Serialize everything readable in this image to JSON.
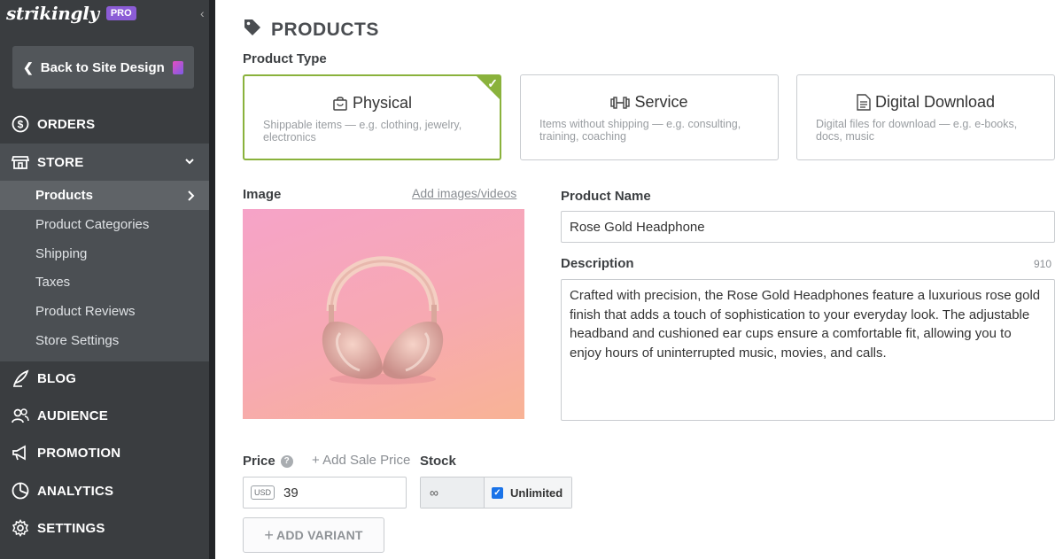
{
  "brand": {
    "logo": "strikingly",
    "badge": "PRO"
  },
  "sidebar": {
    "back_label": "Back to Site Design",
    "items": [
      {
        "label": "ORDERS",
        "icon": "dollar-circle-icon"
      },
      {
        "label": "STORE",
        "icon": "storefront-icon"
      },
      {
        "label": "BLOG",
        "icon": "quill-icon"
      },
      {
        "label": "AUDIENCE",
        "icon": "people-icon"
      },
      {
        "label": "PROMOTION",
        "icon": "megaphone-icon"
      },
      {
        "label": "ANALYTICS",
        "icon": "pie-chart-icon"
      },
      {
        "label": "SETTINGS",
        "icon": "gear-icon"
      }
    ],
    "store_sub": [
      "Products",
      "Product Categories",
      "Shipping",
      "Taxes",
      "Product Reviews",
      "Store Settings"
    ],
    "active_sub": "Products"
  },
  "main": {
    "title": "PRODUCTS",
    "product_type_label": "Product Type",
    "types": [
      {
        "title": "Physical",
        "desc": "Shippable items — e.g. clothing, jewelry, electronics",
        "icon": "shopping-bag-icon",
        "selected": true
      },
      {
        "title": "Service",
        "desc": "Items without shipping — e.g. consulting, training, coaching",
        "icon": "dumbbell-icon",
        "selected": false
      },
      {
        "title": "Digital Download",
        "desc": "Digital files for download — e.g. e-books, docs, music",
        "icon": "document-icon",
        "selected": false
      }
    ],
    "image_label": "Image",
    "add_images": "Add images/videos",
    "name_label": "Product Name",
    "name_value": "Rose Gold Headphone",
    "desc_label": "Description",
    "desc_count": "910",
    "desc_value": "Crafted with precision, the Rose Gold Headphones feature a luxurious rose gold finish that adds a touch of sophistication to your everyday look. The adjustable headband and cushioned ear cups ensure a comfortable fit, allowing you to enjoy hours of uninterrupted music, movies, and calls.",
    "price_label": "Price",
    "sale_price": "+ Add Sale Price",
    "currency": "USD",
    "price_value": "39",
    "stock_label": "Stock",
    "stock_value": "∞",
    "unlimited_label": "Unlimited",
    "unlimited_checked": true,
    "add_variant": "ADD VARIANT"
  },
  "colors": {
    "accent_green": "#8ab23c",
    "sidebar_bg": "#3a3d40",
    "pro_purple": "#8b5cd6"
  }
}
